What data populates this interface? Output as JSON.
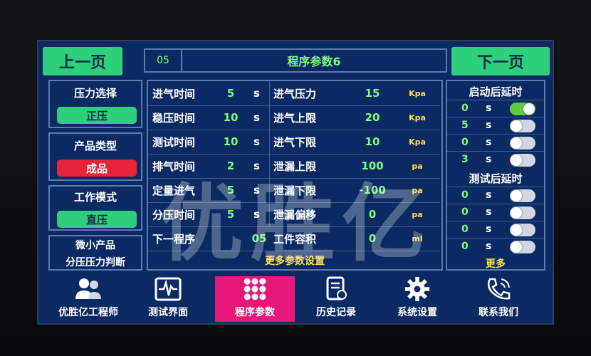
{
  "nav": {
    "prev_label": "上一页",
    "next_label": "下一页"
  },
  "header": {
    "program_no": "05",
    "title": "程序参数6"
  },
  "left": {
    "pressure_select": {
      "label": "压力选择",
      "value": "正压"
    },
    "product_type": {
      "label": "产品类型",
      "value": "成品"
    },
    "work_mode": {
      "label": "工作模式",
      "value": "直压"
    },
    "micro_product": {
      "line1": "微小产品",
      "line2": "分压压力判断"
    }
  },
  "params_left": [
    {
      "label": "进气时间",
      "value": "5",
      "unit": "s"
    },
    {
      "label": "稳压时间",
      "value": "10",
      "unit": "s"
    },
    {
      "label": "测试时间",
      "value": "10",
      "unit": "s"
    },
    {
      "label": "排气时间",
      "value": "2",
      "unit": "s"
    },
    {
      "label": "定量进气",
      "value": "5",
      "unit": "s"
    },
    {
      "label": "分压时间",
      "value": "5",
      "unit": "s"
    }
  ],
  "params_right": [
    {
      "label": "进气压力",
      "value": "15",
      "unit": "Kpa"
    },
    {
      "label": "进气上限",
      "value": "20",
      "unit": "Kpa"
    },
    {
      "label": "进气下限",
      "value": "10",
      "unit": "Kpa"
    },
    {
      "label": "泄漏上限",
      "value": "100",
      "unit": "pa"
    },
    {
      "label": "泄漏下限",
      "value": "-100",
      "unit": "pa"
    },
    {
      "label": "泄漏偏移",
      "value": "0",
      "unit": "pa"
    }
  ],
  "next_program": {
    "label": "下一程序",
    "value": "05"
  },
  "workpiece_volume": {
    "label": "工件容积",
    "value": "0",
    "unit": "ml"
  },
  "more_params": "更多参数设置",
  "start_delay": {
    "title": "启动后延时",
    "rows": [
      {
        "value": "0",
        "unit": "s",
        "on": true
      },
      {
        "value": "5",
        "unit": "s",
        "on": false
      },
      {
        "value": "0",
        "unit": "s",
        "on": false
      },
      {
        "value": "3",
        "unit": "s",
        "on": false
      }
    ]
  },
  "test_delay": {
    "title": "测试后延时",
    "rows": [
      {
        "value": "0",
        "unit": "s",
        "on": false
      },
      {
        "value": "0",
        "unit": "s",
        "on": false
      },
      {
        "value": "0",
        "unit": "s",
        "on": false
      },
      {
        "value": "0",
        "unit": "s",
        "on": false
      }
    ]
  },
  "more": "更多",
  "bottom_nav": [
    {
      "label": "优胜亿工程师",
      "icon": "engineer-icon"
    },
    {
      "label": "测试界面",
      "icon": "monitor-icon"
    },
    {
      "label": "程序参数",
      "icon": "grid-icon"
    },
    {
      "label": "历史记录",
      "icon": "history-icon"
    },
    {
      "label": "系统设置",
      "icon": "gear-icon"
    },
    {
      "label": "联系我们",
      "icon": "phone-icon"
    }
  ],
  "watermark": "优胜亿",
  "colors": {
    "accent_green": "#2ecf7a",
    "screen_blue": "#0b2a63",
    "alert_red": "#e8243a",
    "active_pink": "#e8177a",
    "value_green": "#7cfc7c",
    "unit_yellow": "#ffe14a"
  }
}
